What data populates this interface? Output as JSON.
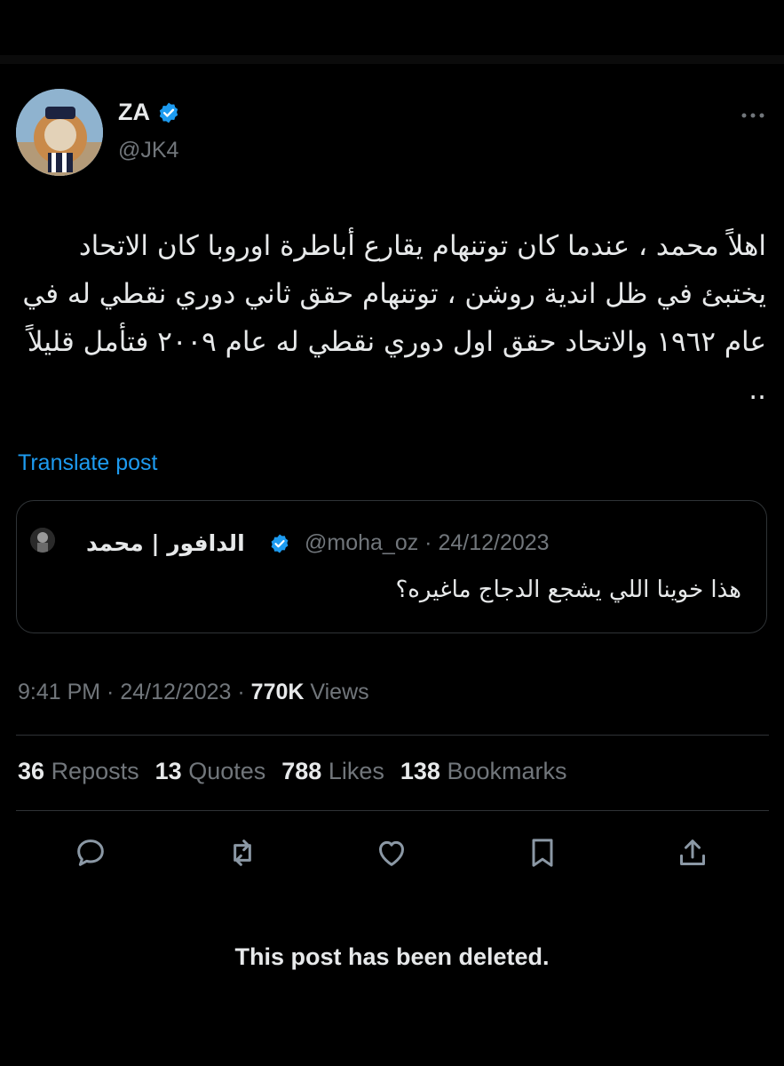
{
  "author": {
    "display_name": "ZA",
    "handle": "@JK4",
    "verified": true
  },
  "tweet": {
    "text": "اهلاً محمد ، عندما كان توتنهام يقارع أباطرة اوروبا  كان الاتحاد يختبئ في ظل اندية روشن ، توتنهام حقق ثاني دوري نقطي له في عام ١٩٦٢ والاتحاد حقق اول دوري نقطي له عام ٢٠٠٩ فتأمل قليلاً ..",
    "translate_label": "Translate post"
  },
  "quoted": {
    "name": "الدافور | محمد",
    "handle_date": "@moha_oz · 24/12/2023",
    "text": "هذا خوينا اللي يشجع الدجاج ماغيره؟"
  },
  "meta": {
    "time_date": "9:41 PM · 24/12/2023 · ",
    "views_count": "770K",
    "views_label": " Views"
  },
  "stats": [
    {
      "count": "36",
      "label": "Reposts"
    },
    {
      "count": "13",
      "label": "Quotes"
    },
    {
      "count": "788",
      "label": "Likes"
    },
    {
      "count": "138",
      "label": "Bookmarks"
    }
  ],
  "actions": [
    "reply-icon",
    "repost-icon",
    "like-icon",
    "bookmark-icon",
    "share-icon"
  ],
  "notice": "This post has been deleted.",
  "colors": {
    "background": "#000000",
    "text": "#e7e9ea",
    "muted": "#71767b",
    "accent": "#1d9bf0",
    "border": "#2f3336"
  }
}
